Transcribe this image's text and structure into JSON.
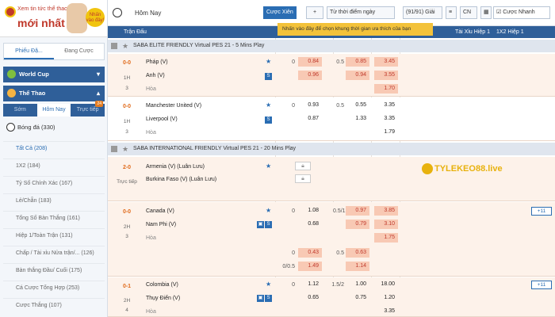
{
  "banner": {
    "top": "Xem tin tức thể thao",
    "main": "mới nhất",
    "badge": "Nhấn vào đây!"
  },
  "sidebar": {
    "tabs": [
      "Phiếu Đặ...",
      "Đang Cược"
    ],
    "world_cup": "World Cup",
    "sports": "Thể Thao",
    "subtabs": [
      "Sớm",
      "Hôm Nay",
      "Trực tiếp"
    ],
    "live_count": "24",
    "football": "Bóng đá (330)",
    "items": [
      "Tất Cả (208)",
      "1X2 (184)",
      "Tỷ Số Chính Xác (167)",
      "Lẻ/Chẵn (183)",
      "Tổng Số Bàn Thắng (161)",
      "Hiệp 1/Toàn Trận (131)",
      "Chấp / Tài xỉu Nửa trận/... (126)",
      "Bàn thắng Đầu/ Cuối (175)",
      "Cá Cược Tổng Hợp (253)",
      "Cược Thắng (107)"
    ]
  },
  "toolbar": {
    "title": "Hôm Nay",
    "bet_button": "Cược Xiên",
    "add": "+",
    "sort": "Từ thời điểm ngày",
    "range": "(91/91) Giải",
    "odds_type": "CN",
    "quick_bet": "Cược Nhanh"
  },
  "tooltip": "Nhấn vào đây để chọn khung thời gian ưa thích của bạn",
  "columns": {
    "match": "Trận Đấu",
    "ou_h1": "Tài Xỉu Hiệp 1",
    "x12_h1": "1X2 Hiệp 1"
  },
  "leagues": [
    "SABA ELITE FRIENDLY Virtual PES 21 - 5 Mins Play",
    "SABA INTERNATIONAL FRIENDLY Virtual PES 21 - 20 Mins Play"
  ],
  "matches": [
    {
      "score": "0-0",
      "period": "1H",
      "minute": "3",
      "home": "Pháp (V)",
      "away": "Anh (V)",
      "draw": "Hòa",
      "h1": "0",
      "o1": "0.84",
      "h2": "0.5",
      "o2": "0.85",
      "o3": "3.45",
      "a1": "0.96",
      "a2": "0.94",
      "a3": "3.55",
      "d3": "1.70"
    },
    {
      "score": "0-0",
      "period": "1H",
      "minute": "3",
      "home": "Manchester United (V)",
      "away": "Liverpool (V)",
      "draw": "Hòa",
      "h1": "0",
      "o1": "0.93",
      "h2": "0.5",
      "o2": "0.55",
      "o3": "3.35",
      "a1": "0.87",
      "a2": "1.33",
      "a3": "3.35",
      "d3": "1.79"
    },
    {
      "score": "2-0",
      "period": "Trực tiếp",
      "home": "Armenia (V) (Luân Lưu)",
      "away": "Burkina Faso (V) (Luân Lưu)"
    },
    {
      "score": "0-0",
      "period": "2H",
      "minute": "3",
      "home": "Canada (V)",
      "away": "Nam Phi (V)",
      "draw": "Hòa",
      "h1": "0",
      "o1": "1.08",
      "h2": "0.5/1",
      "o2": "0.97",
      "o3": "3.85",
      "a1": "0.68",
      "a2": "0.79",
      "a3": "3.10",
      "d3": "1.75",
      "more": "+11",
      "extra": {
        "e1": "0.43",
        "eh2": "0.5",
        "e2": "0.63",
        "eh1": "0/0.5",
        "e3": "1.49",
        "eh3": "0",
        "e4": "1.14"
      }
    },
    {
      "score": "0-1",
      "period": "2H",
      "minute": "4",
      "home": "Colombia (V)",
      "away": "Thụy Điển (V)",
      "draw": "Hòa",
      "h1": "0",
      "o1": "1.12",
      "h2": "1.5/2",
      "o2": "1.00",
      "o3": "18.00",
      "a1": "0.65",
      "a2": "0.75",
      "a3": "1.20",
      "d3": "3.35",
      "more": "+11"
    }
  ],
  "watermark": "TYLEKEO88.live"
}
